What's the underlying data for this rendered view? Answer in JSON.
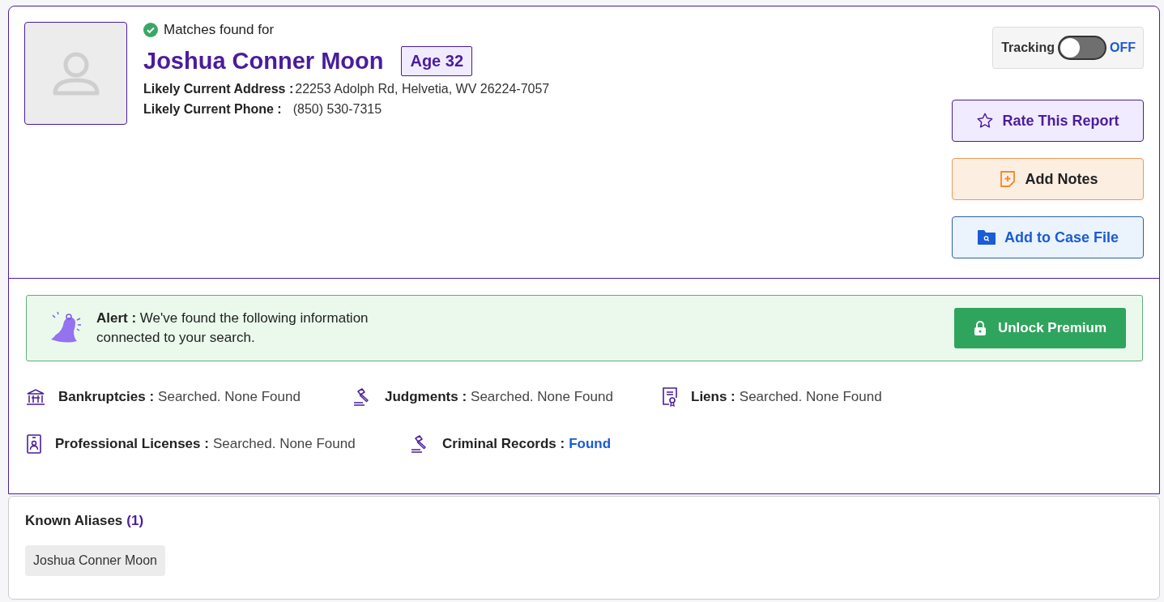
{
  "header": {
    "match_label": "Matches found for",
    "name": "Joshua Conner Moon",
    "age": "Age 32",
    "details": [
      {
        "label": "Likely Current Address :",
        "value": "22253 Adolph Rd, Helvetia, WV 26224-7057"
      },
      {
        "label": "Likely Current Phone :",
        "value": "(850) 530-7315"
      }
    ]
  },
  "tracking": {
    "label": "Tracking",
    "on": false,
    "state_text": "OFF"
  },
  "actions": [
    {
      "kind": "rate",
      "label": "Rate This Report"
    },
    {
      "kind": "notes",
      "label": "Add Notes"
    },
    {
      "kind": "case",
      "label": "Add to Case File"
    }
  ],
  "alert": {
    "text": "**Alert :** We've found the following information connected to your search.",
    "button": "Unlock Premium"
  },
  "records": [
    {
      "kind": "bank",
      "label": "Bankruptcies :",
      "value": "Searched. None Found",
      "found": false
    },
    {
      "kind": "gavel",
      "label": "Judgments :",
      "value": "Searched. None Found",
      "found": false
    },
    {
      "kind": "lien",
      "label": "Liens :",
      "value": "Searched. None Found",
      "found": false
    },
    {
      "kind": "badge",
      "label": "Professional Licenses :",
      "value": "Searched. None Found",
      "found": false
    },
    {
      "kind": "gavel",
      "label": "Criminal Records :",
      "value": "Found",
      "found": true
    }
  ],
  "aliases": {
    "title": "Known Aliases",
    "count": "(1)",
    "items": [
      "Joshua Conner Moon"
    ]
  }
}
